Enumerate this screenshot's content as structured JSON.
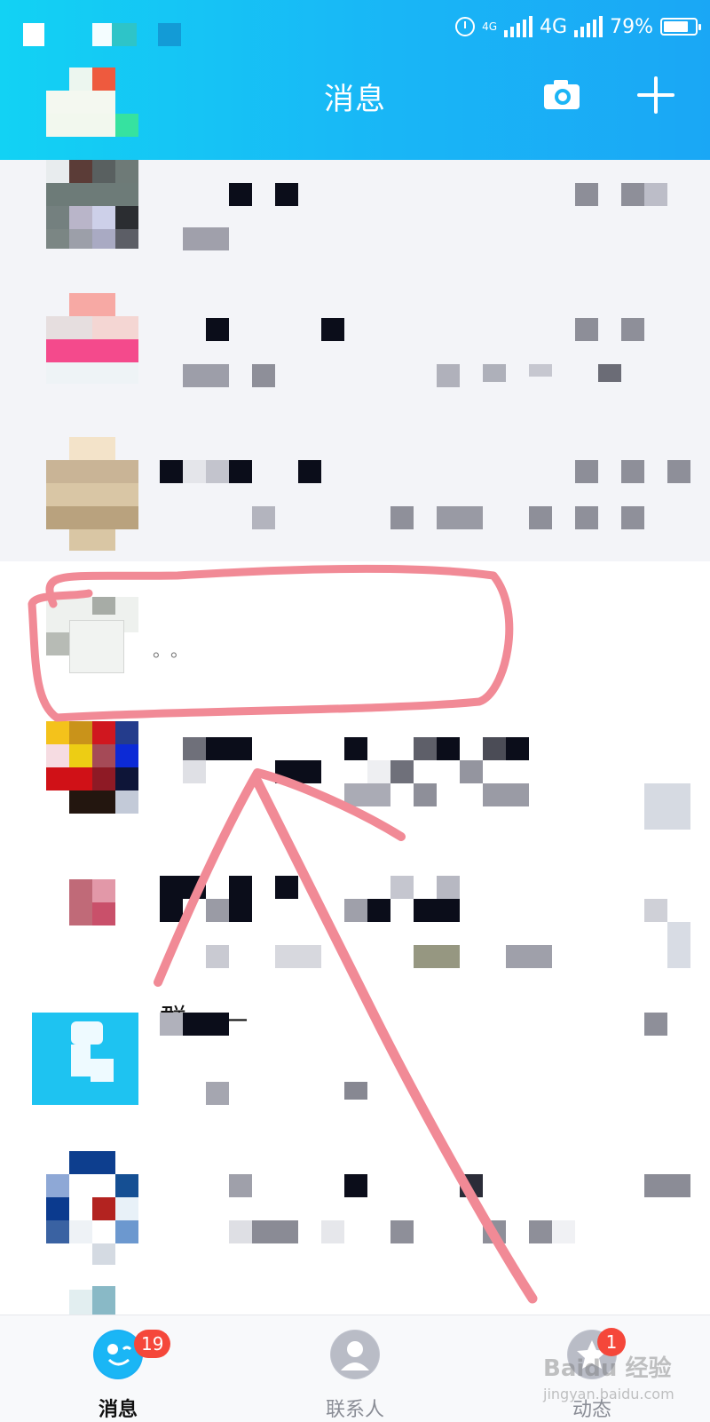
{
  "header": {
    "title": "消息",
    "camera_icon": "camera-icon",
    "add_icon": "plus-icon"
  },
  "status_bar": {
    "network_top": "4G",
    "network": "4G",
    "battery": "79%",
    "battery_level": 0.79
  },
  "list": {
    "group_prefix": "群… —",
    "last_preview": "。。"
  },
  "tabs": [
    {
      "label": "消息",
      "badge": "19",
      "icon": "chat-bubble-icon",
      "active": true
    },
    {
      "label": "联系人",
      "icon": "contact-person-icon",
      "active": false
    },
    {
      "label": "动态",
      "badge": "1",
      "icon": "star-dynamic-icon",
      "active": false
    }
  ],
  "watermark": {
    "brand": "Baidu 经验",
    "url": "jingyan.baidu.com"
  },
  "colors": {
    "header": "#18b9f5",
    "badge": "#f5473a",
    "annotation": "#f08a96",
    "active_tab": "#1ab0f4"
  }
}
